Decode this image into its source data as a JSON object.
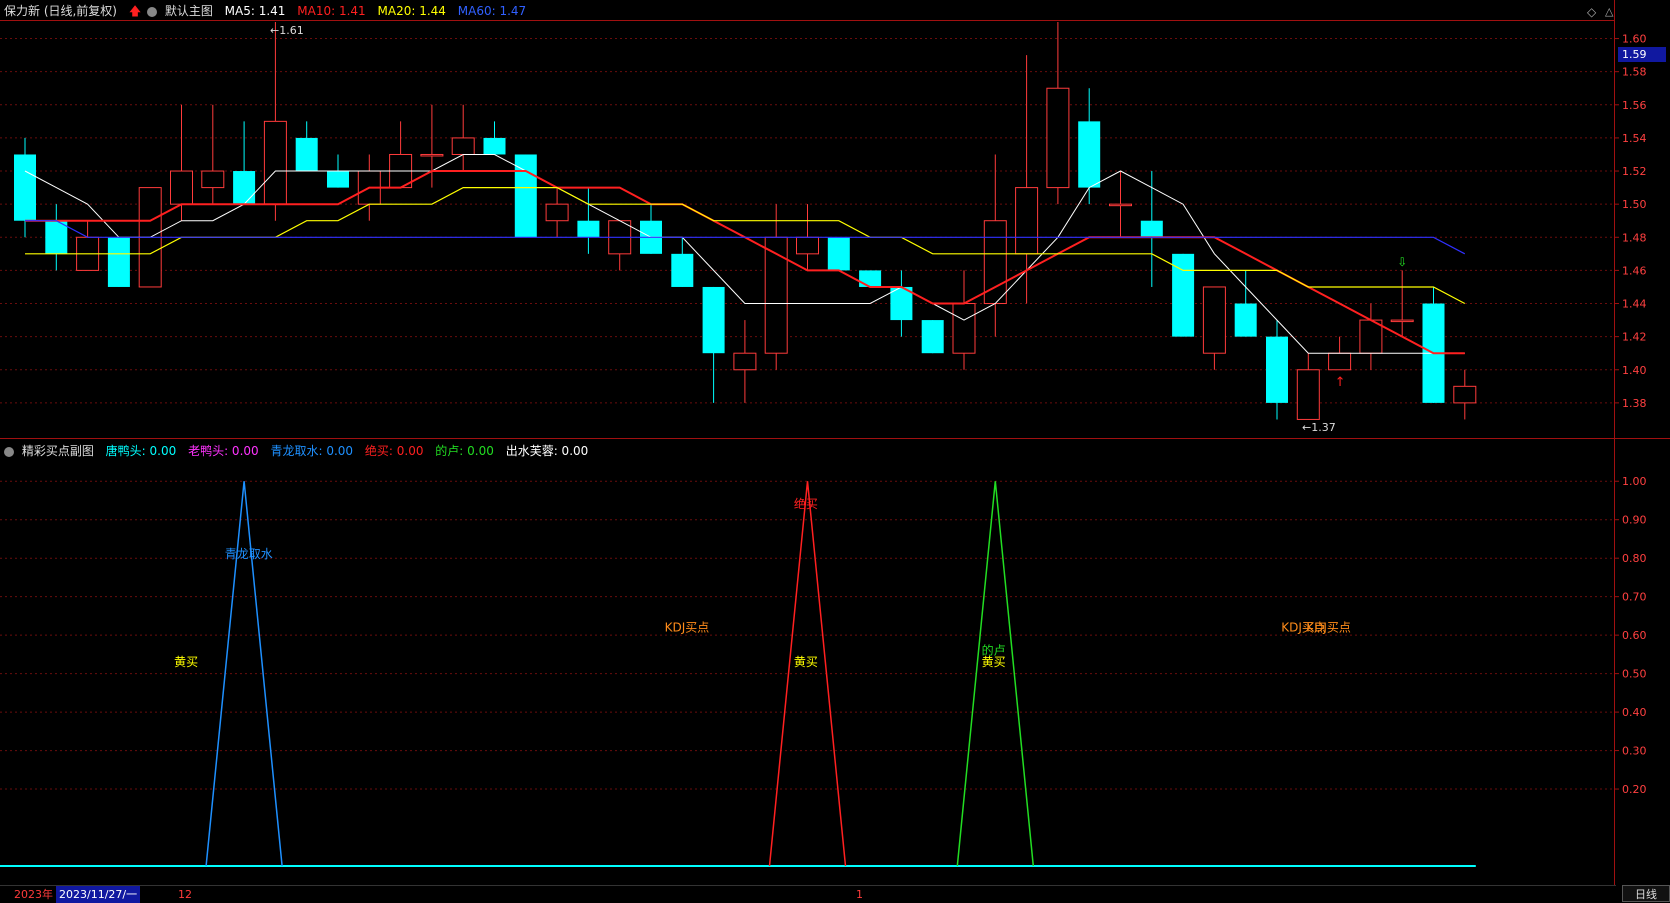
{
  "main_header": {
    "stock": "保力新 (日线,前复权)",
    "chart_name": "默认主图",
    "ma5": "MA5: 1.41",
    "ma10": "MA10: 1.41",
    "ma20": "MA20: 1.44",
    "ma60": "MA60: 1.47"
  },
  "sub_header": {
    "name": "精彩买点副图",
    "tang": "唐鸭头: 0.00",
    "lao": "老鸭头: 0.00",
    "qing": "青龙取水: 0.00",
    "jue": "绝买: 0.00",
    "dilu": "的卢: 0.00",
    "chu": "出水芙蓉: 0.00"
  },
  "bottom": {
    "year": "2023年",
    "date": "2023/11/27/一",
    "m12": "12",
    "m1": "1"
  },
  "timeframe": "日线",
  "current_price": "1.59",
  "price_max_label": "1.61",
  "price_min_label": "1.37",
  "colors": {
    "up": "#ff3b3b",
    "down": "#00ffff",
    "ma5": "#ffffff",
    "ma10": "#ff2020",
    "ma20": "#ffff00",
    "ma60": "#3030ff"
  },
  "chart_data": [
    {
      "type": "candlestick",
      "title": "保力新 (日线,前复权)",
      "ylim": [
        1.36,
        1.61
      ],
      "y_ticks": [
        "1.60",
        "1.58",
        "1.56",
        "1.54",
        "1.52",
        "1.50",
        "1.48",
        "1.46",
        "1.44",
        "1.42",
        "1.40",
        "1.38"
      ],
      "candles": [
        {
          "o": 1.53,
          "h": 1.54,
          "l": 1.48,
          "c": 1.49
        },
        {
          "o": 1.49,
          "h": 1.5,
          "l": 1.46,
          "c": 1.47
        },
        {
          "o": 1.46,
          "h": 1.49,
          "l": 1.46,
          "c": 1.48
        },
        {
          "o": 1.48,
          "h": 1.48,
          "l": 1.45,
          "c": 1.45
        },
        {
          "o": 1.45,
          "h": 1.51,
          "l": 1.45,
          "c": 1.51
        },
        {
          "o": 1.5,
          "h": 1.56,
          "l": 1.49,
          "c": 1.52
        },
        {
          "o": 1.51,
          "h": 1.56,
          "l": 1.5,
          "c": 1.52
        },
        {
          "o": 1.52,
          "h": 1.55,
          "l": 1.5,
          "c": 1.5
        },
        {
          "o": 1.5,
          "h": 1.61,
          "l": 1.49,
          "c": 1.55
        },
        {
          "o": 1.54,
          "h": 1.55,
          "l": 1.52,
          "c": 1.52
        },
        {
          "o": 1.52,
          "h": 1.53,
          "l": 1.51,
          "c": 1.51
        },
        {
          "o": 1.5,
          "h": 1.53,
          "l": 1.49,
          "c": 1.52
        },
        {
          "o": 1.51,
          "h": 1.55,
          "l": 1.51,
          "c": 1.53
        },
        {
          "o": 1.53,
          "h": 1.56,
          "l": 1.51,
          "c": 1.53
        },
        {
          "o": 1.53,
          "h": 1.56,
          "l": 1.52,
          "c": 1.54
        },
        {
          "o": 1.54,
          "h": 1.55,
          "l": 1.53,
          "c": 1.53
        },
        {
          "o": 1.53,
          "h": 1.53,
          "l": 1.48,
          "c": 1.48
        },
        {
          "o": 1.49,
          "h": 1.51,
          "l": 1.48,
          "c": 1.5
        },
        {
          "o": 1.49,
          "h": 1.51,
          "l": 1.47,
          "c": 1.48
        },
        {
          "o": 1.47,
          "h": 1.49,
          "l": 1.46,
          "c": 1.49
        },
        {
          "o": 1.49,
          "h": 1.5,
          "l": 1.47,
          "c": 1.47
        },
        {
          "o": 1.47,
          "h": 1.48,
          "l": 1.45,
          "c": 1.45
        },
        {
          "o": 1.45,
          "h": 1.45,
          "l": 1.38,
          "c": 1.41
        },
        {
          "o": 1.4,
          "h": 1.43,
          "l": 1.38,
          "c": 1.41
        },
        {
          "o": 1.41,
          "h": 1.5,
          "l": 1.4,
          "c": 1.48
        },
        {
          "o": 1.47,
          "h": 1.5,
          "l": 1.46,
          "c": 1.48
        },
        {
          "o": 1.48,
          "h": 1.48,
          "l": 1.46,
          "c": 1.46
        },
        {
          "o": 1.46,
          "h": 1.46,
          "l": 1.45,
          "c": 1.45
        },
        {
          "o": 1.45,
          "h": 1.46,
          "l": 1.42,
          "c": 1.43
        },
        {
          "o": 1.43,
          "h": 1.43,
          "l": 1.41,
          "c": 1.41
        },
        {
          "o": 1.41,
          "h": 1.46,
          "l": 1.4,
          "c": 1.44
        },
        {
          "o": 1.44,
          "h": 1.53,
          "l": 1.42,
          "c": 1.49
        },
        {
          "o": 1.47,
          "h": 1.59,
          "l": 1.44,
          "c": 1.51
        },
        {
          "o": 1.51,
          "h": 1.61,
          "l": 1.5,
          "c": 1.57
        },
        {
          "o": 1.55,
          "h": 1.57,
          "l": 1.5,
          "c": 1.51
        },
        {
          "o": 1.5,
          "h": 1.52,
          "l": 1.48,
          "c": 1.5
        },
        {
          "o": 1.49,
          "h": 1.52,
          "l": 1.45,
          "c": 1.48
        },
        {
          "o": 1.47,
          "h": 1.47,
          "l": 1.42,
          "c": 1.42
        },
        {
          "o": 1.41,
          "h": 1.45,
          "l": 1.4,
          "c": 1.45
        },
        {
          "o": 1.44,
          "h": 1.46,
          "l": 1.42,
          "c": 1.42
        },
        {
          "o": 1.42,
          "h": 1.43,
          "l": 1.37,
          "c": 1.38
        },
        {
          "o": 1.37,
          "h": 1.41,
          "l": 1.37,
          "c": 1.4
        },
        {
          "o": 1.4,
          "h": 1.42,
          "l": 1.4,
          "c": 1.41
        },
        {
          "o": 1.41,
          "h": 1.44,
          "l": 1.4,
          "c": 1.43
        },
        {
          "o": 1.43,
          "h": 1.46,
          "l": 1.42,
          "c": 1.43
        },
        {
          "o": 1.44,
          "h": 1.45,
          "l": 1.38,
          "c": 1.38
        },
        {
          "o": 1.38,
          "h": 1.4,
          "l": 1.37,
          "c": 1.39
        }
      ],
      "series": [
        {
          "name": "MA5",
          "values": [
            1.52,
            1.51,
            1.5,
            1.48,
            1.48,
            1.49,
            1.49,
            1.5,
            1.52,
            1.52,
            1.52,
            1.52,
            1.52,
            1.52,
            1.53,
            1.53,
            1.52,
            1.51,
            1.5,
            1.49,
            1.48,
            1.48,
            1.46,
            1.44,
            1.44,
            1.44,
            1.44,
            1.44,
            1.45,
            1.44,
            1.43,
            1.44,
            1.46,
            1.48,
            1.51,
            1.52,
            1.51,
            1.5,
            1.47,
            1.45,
            1.43,
            1.41,
            1.41,
            1.41,
            1.41,
            1.41,
            1.41
          ]
        },
        {
          "name": "MA10",
          "values": [
            1.49,
            1.49,
            1.49,
            1.49,
            1.49,
            1.5,
            1.5,
            1.5,
            1.5,
            1.5,
            1.5,
            1.51,
            1.51,
            1.52,
            1.52,
            1.52,
            1.52,
            1.51,
            1.51,
            1.51,
            1.5,
            1.5,
            1.49,
            1.48,
            1.47,
            1.46,
            1.46,
            1.45,
            1.45,
            1.44,
            1.44,
            1.45,
            1.46,
            1.47,
            1.48,
            1.48,
            1.48,
            1.48,
            1.48,
            1.47,
            1.46,
            1.45,
            1.44,
            1.43,
            1.42,
            1.41,
            1.41
          ]
        },
        {
          "name": "MA20",
          "values": [
            1.47,
            1.47,
            1.47,
            1.47,
            1.47,
            1.48,
            1.48,
            1.48,
            1.48,
            1.49,
            1.49,
            1.5,
            1.5,
            1.5,
            1.51,
            1.51,
            1.51,
            1.51,
            1.5,
            1.5,
            1.5,
            1.5,
            1.49,
            1.49,
            1.49,
            1.49,
            1.49,
            1.48,
            1.48,
            1.47,
            1.47,
            1.47,
            1.47,
            1.47,
            1.47,
            1.47,
            1.47,
            1.46,
            1.46,
            1.46,
            1.46,
            1.45,
            1.45,
            1.45,
            1.45,
            1.45,
            1.44
          ]
        },
        {
          "name": "MA60",
          "values": [
            1.49,
            1.49,
            1.48,
            1.48,
            1.48,
            1.48,
            1.48,
            1.48,
            1.48,
            1.48,
            1.48,
            1.48,
            1.48,
            1.48,
            1.48,
            1.48,
            1.48,
            1.48,
            1.48,
            1.48,
            1.48,
            1.48,
            1.48,
            1.48,
            1.48,
            1.48,
            1.48,
            1.48,
            1.48,
            1.48,
            1.48,
            1.48,
            1.48,
            1.48,
            1.48,
            1.48,
            1.48,
            1.48,
            1.48,
            1.48,
            1.48,
            1.48,
            1.48,
            1.48,
            1.48,
            1.48,
            1.47
          ]
        }
      ]
    },
    {
      "type": "line",
      "title": "精彩买点副图",
      "ylim": [
        0,
        1.05
      ],
      "y_ticks": [
        "1.00",
        "0.90",
        "0.80",
        "0.70",
        "0.60",
        "0.50",
        "0.40",
        "0.30",
        "0.20"
      ],
      "spikes": [
        {
          "name": "青龙取水",
          "center": 7,
          "value": 1.0,
          "color": "#1e90ff"
        },
        {
          "name": "绝买",
          "center": 25,
          "value": 1.0,
          "color": "#ff2020"
        },
        {
          "name": "的卢",
          "center": 31,
          "value": 1.0,
          "color": "#22dd22"
        }
      ],
      "annotations": [
        {
          "text": "青龙取水",
          "x": 7.5,
          "y": 0.8,
          "color": "#1e90ff"
        },
        {
          "text": "绝买",
          "x": 25.3,
          "y": 0.93,
          "color": "#ff2020"
        },
        {
          "text": "KDJ买点",
          "x": 21.5,
          "y": 0.61,
          "color": "#ff8c1a"
        },
        {
          "text": "KDJ买点",
          "x": 41.2,
          "y": 0.61,
          "color": "#ff8c1a"
        },
        {
          "text": "KDJ买点",
          "x": 42.0,
          "y": 0.61,
          "color": "#ff8c1a"
        },
        {
          "text": "黄买",
          "x": 5.5,
          "y": 0.52,
          "color": "#ffff00"
        },
        {
          "text": "黄买",
          "x": 25.3,
          "y": 0.52,
          "color": "#ffff00"
        },
        {
          "text": "的卢",
          "x": 31.3,
          "y": 0.55,
          "color": "#22dd22"
        },
        {
          "text": "黄买",
          "x": 31.3,
          "y": 0.52,
          "color": "#ffff00"
        }
      ]
    }
  ]
}
